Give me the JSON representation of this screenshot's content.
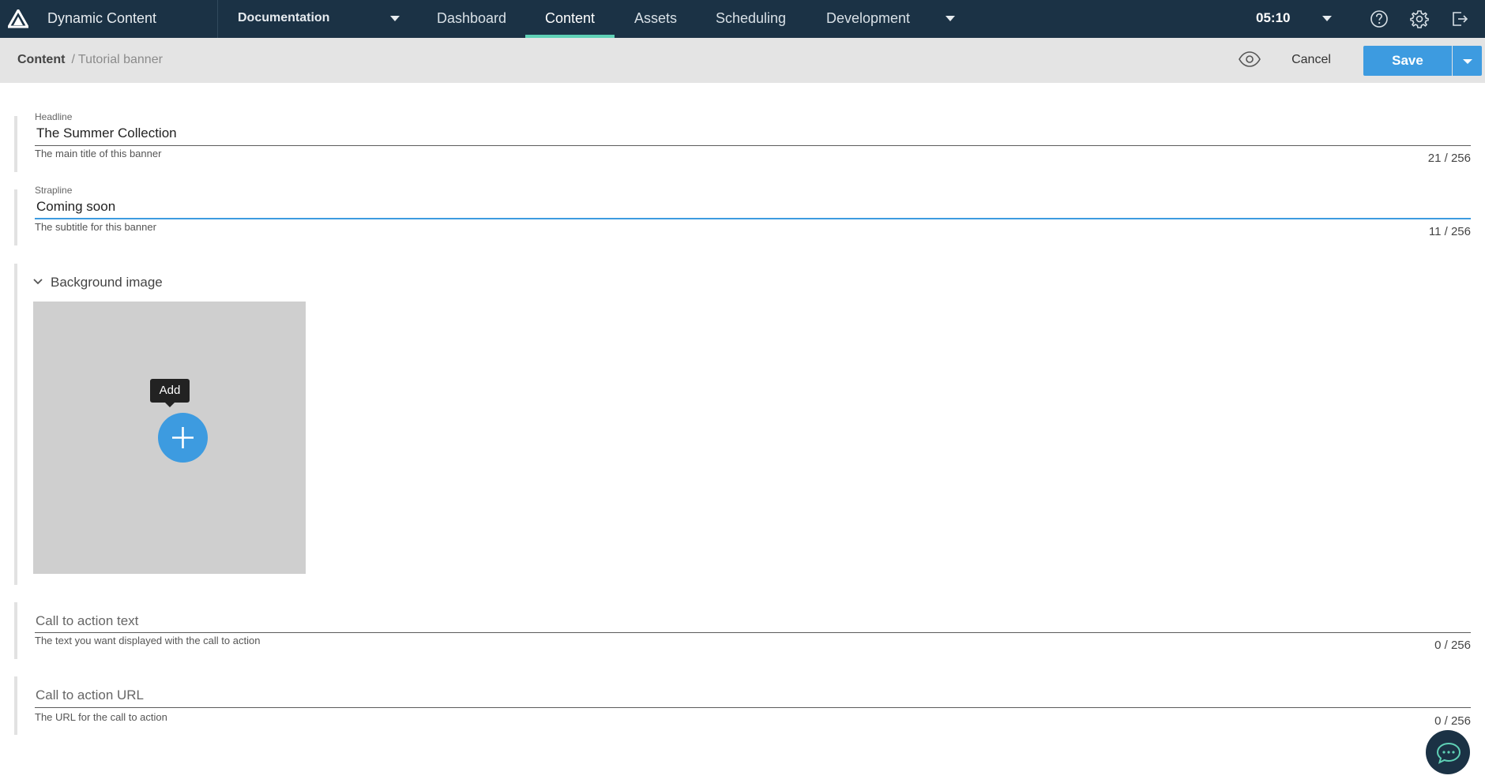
{
  "topbar": {
    "app_name": "Dynamic Content",
    "hub_name": "Documentation",
    "tabs": [
      {
        "label": "Dashboard",
        "active": false
      },
      {
        "label": "Content",
        "active": true
      },
      {
        "label": "Assets",
        "active": false
      },
      {
        "label": "Scheduling",
        "active": false
      },
      {
        "label": "Development",
        "active": false
      }
    ],
    "clock": "05:10",
    "accent_color": "#5fd1b6",
    "background_color": "#1b3245"
  },
  "subheader": {
    "breadcrumb": [
      "Content",
      "Tutorial banner"
    ],
    "breadcrumb_separator": "/",
    "cancel_label": "Cancel",
    "save_label": "Save",
    "save_color": "#3d9be0"
  },
  "form": {
    "headline": {
      "label": "Headline",
      "value": "The Summer Collection",
      "help": "The main title of this banner",
      "count": "21 / 256"
    },
    "strapline": {
      "label": "Strapline",
      "value": "Coming soon",
      "help": "The subtitle for this banner",
      "count": "11 / 256"
    },
    "background_image": {
      "title": "Background image",
      "add_tooltip": "Add"
    },
    "cta_text": {
      "placeholder": "Call to action text",
      "help": "The text you want displayed with the call to action",
      "count": "0 / 256"
    },
    "cta_url": {
      "placeholder": "Call to action URL",
      "help": "The URL for the call to action",
      "count": "0 / 256"
    }
  },
  "icons": [
    "logo-icon",
    "chevron-down-icon",
    "help-icon",
    "gear-icon",
    "logout-icon",
    "eye-icon",
    "plus-icon",
    "chat-icon"
  ]
}
